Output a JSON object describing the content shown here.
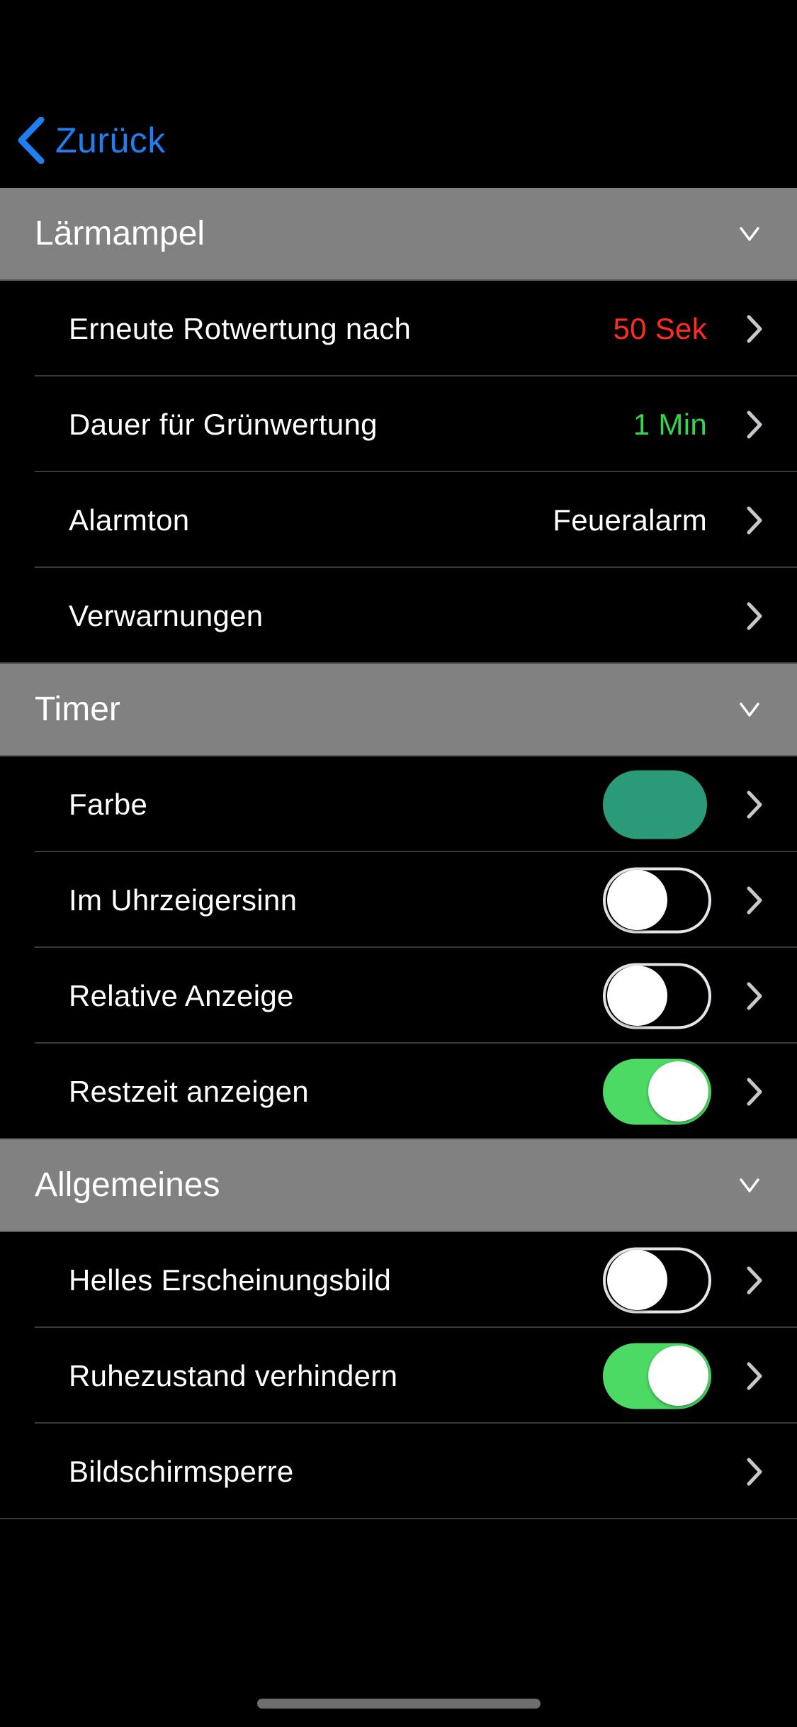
{
  "nav": {
    "back_label": "Zurück"
  },
  "colors": {
    "accent_blue": "#1f7ef0",
    "value_red": "#ff2d20",
    "value_green": "#32d74b",
    "timer_color_swatch": "#2a9a78",
    "toggle_on": "#4cd964",
    "section_header_bg": "#818181"
  },
  "sections": {
    "laermampel": {
      "title": "Lärmampel",
      "collapse_icon": "chevron-down-icon",
      "rows": {
        "rotwertung": {
          "label": "Erneute Rotwertung nach",
          "value": "50 Sek",
          "value_color": "#ff2d20"
        },
        "gruenwertung": {
          "label": "Dauer für Grünwertung",
          "value": "1 Min",
          "value_color": "#32d74b"
        },
        "alarmton": {
          "label": "Alarmton",
          "value": "Feueralarm",
          "value_color": "#ffffff"
        },
        "verwarnungen": {
          "label": "Verwarnungen"
        }
      }
    },
    "timer": {
      "title": "Timer",
      "collapse_icon": "chevron-down-icon",
      "rows": {
        "farbe": {
          "label": "Farbe",
          "swatch_color": "#2a9a78"
        },
        "uhrzeigersinn": {
          "label": "Im Uhrzeigersinn",
          "on": false
        },
        "relative": {
          "label": "Relative Anzeige",
          "on": false
        },
        "restzeit": {
          "label": "Restzeit anzeigen",
          "on": true
        }
      }
    },
    "allgemeines": {
      "title": "Allgemeines",
      "collapse_icon": "chevron-down-icon",
      "rows": {
        "hell": {
          "label": "Helles Erscheinungsbild",
          "on": false
        },
        "ruhezustand": {
          "label": "Ruhezustand verhindern",
          "on": true
        },
        "bildschirmsperre": {
          "label": "Bildschirmsperre"
        }
      }
    }
  }
}
